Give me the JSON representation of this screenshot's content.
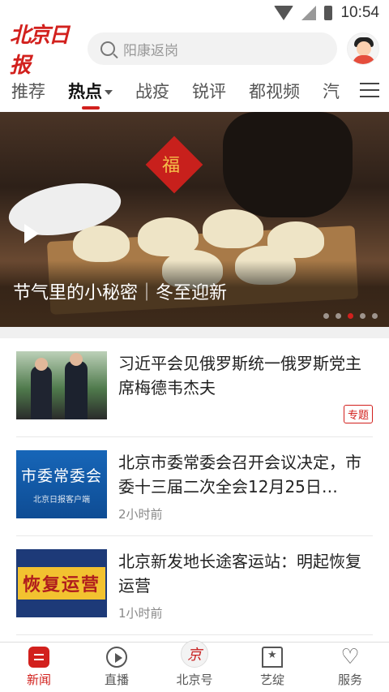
{
  "status": {
    "time": "10:54"
  },
  "header": {
    "logo": "北京日报",
    "search_placeholder": "阳康返岗"
  },
  "tabs": [
    {
      "label": "推荐"
    },
    {
      "label": "热点"
    },
    {
      "label": "战疫"
    },
    {
      "label": "锐评"
    },
    {
      "label": "都视频"
    },
    {
      "label": "汽"
    }
  ],
  "banner": {
    "caption": "节气里的小秘密｜冬至迎新",
    "fu_char": "福",
    "active_slide": 3,
    "slide_count": 5
  },
  "news": [
    {
      "title": "习近平会见俄罗斯统一俄罗斯党主席梅德韦杰夫",
      "tag": "专题",
      "time": ""
    },
    {
      "title": "北京市委常委会召开会议决定，市委十三届二次全会12月25日…",
      "thumb_text": "市委常委会",
      "thumb_sub": "北京日报客户端",
      "time": "2小时前"
    },
    {
      "title": "北京新发地长途客运站：明起恢复运营",
      "thumb_text": "恢复运营",
      "time": "1小时前"
    }
  ],
  "bottom_nav": [
    {
      "label": "新闻"
    },
    {
      "label": "直播"
    },
    {
      "label": "北京号",
      "badge": "京"
    },
    {
      "label": "艺绽"
    },
    {
      "label": "服务"
    }
  ],
  "colors": {
    "brand": "#d2201d"
  }
}
